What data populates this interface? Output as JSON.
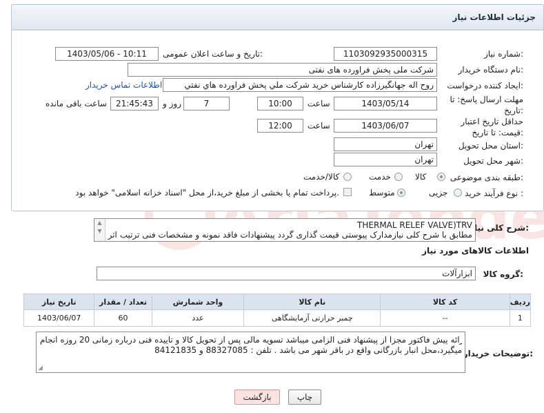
{
  "panel_title": "جزئیات اطلاعات نیاز",
  "fields": {
    "need_number_label": "شماره نیاز:",
    "need_number": "1103092935000315",
    "announce_label": "تاریخ و ساعت اعلان عمومی:",
    "announce_value": "1403/05/06 - 10:11",
    "buyer_org_label": "نام دستگاه خریدار:",
    "buyer_org": "شرکت ملی پخش فراورده های نفتی",
    "creator_label": "ایجاد کننده درخواست:",
    "creator": "روح اله جهانگیرزاده کارشناس خرید شرکت ملي پخش فراورده هاي نفتي",
    "contact_link": "اطلاعات تماس خریدار",
    "deadline_label": "مهلت ارسال پاسخ: تا تاریخ:",
    "deadline_date": "1403/05/14",
    "time_label": "ساعت",
    "deadline_time": "10:00",
    "days_value": "7",
    "days_label": "روز و",
    "remaining_time": "21:45:43",
    "remaining_label": "ساعت باقی مانده",
    "validity_label": "حداقل تاریخ اعتبار قیمت: تا تاریخ:",
    "validity_date": "1403/06/07",
    "validity_time": "12:00",
    "province_label": "استان محل تحویل:",
    "province": "تهران",
    "city_label": "شهر محل تحویل:",
    "city": "تهران",
    "category_label": "طبقه بندی موضوعی:",
    "category_options": [
      "کالا",
      "خدمت",
      "کالا/خدمت"
    ],
    "process_label": "نوع فرآیند خرید :",
    "process_options": [
      "جزیی",
      "متوسط"
    ],
    "payment_note": "پرداخت تمام یا بخشی از مبلغ خرید،از محل \"اسناد خزانه اسلامی\" خواهد بود."
  },
  "description": {
    "label": "شرح کلی نیاز:",
    "line1": "THERMAL RELEF VALVE)TRV",
    "line2": "مطابق با شرح کلی نیازمدارک پیوستی قیمت گذاری گردد پیشنهادات فاقد نمونه و مشخصات فنی ترتیب اثر"
  },
  "goods_section_title": "اطلاعات کالاهای مورد نیاز",
  "goods_group_label": "گروه کالا:",
  "goods_group": "ابزارآلات",
  "table": {
    "headers": [
      "ردیف",
      "کد کالا",
      "نام کالا",
      "واحد شمارش",
      "تعداد / مقدار",
      "تاریخ نیاز"
    ],
    "rows": [
      [
        "1",
        "--",
        "چمبر حرارتی آزمایشگاهی",
        "عدد",
        "60",
        "1403/06/07"
      ]
    ]
  },
  "buyer_notes_label": "توضیحات خریدار:",
  "buyer_notes_line1": "ارائه پیش فاکتور مجزا از پیشنهاد فنی الزامی میباشد تسویه مالی پس از تحویل کالا و تاییده فنی درباره زمانی 20 روزه انجام",
  "buyer_notes_line2": "میگیرد،محل انبار بازرگانی واقع در باقر شهر می باشد . تلفن : 88327085 و 84121835",
  "buttons": {
    "print": "چاپ",
    "back": "بازگشت"
  },
  "watermark_text": "AriaTender.net",
  "colors": {
    "header_bg": "#dbe4ee",
    "link": "#2350a8",
    "back_button": "#fbe3e3"
  }
}
